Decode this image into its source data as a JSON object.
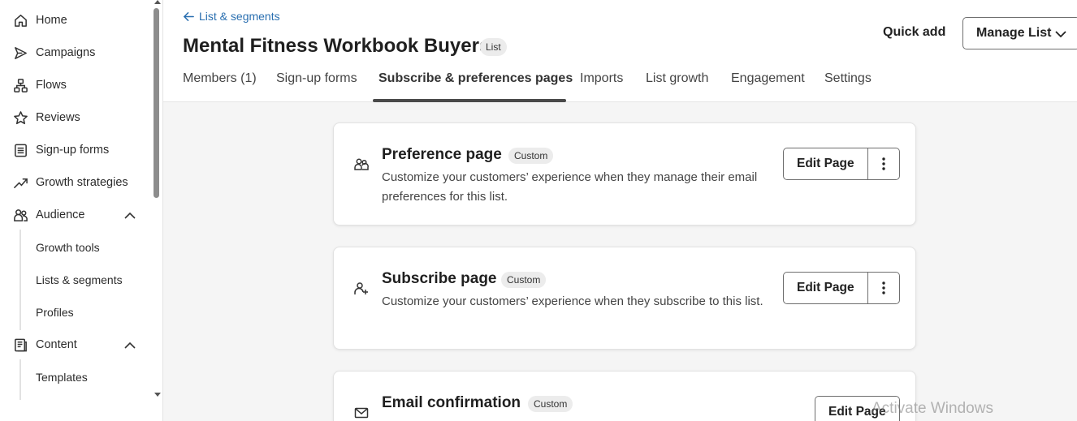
{
  "sidebar": {
    "items": [
      {
        "label": "Home",
        "icon": "home-icon"
      },
      {
        "label": "Campaigns",
        "icon": "send-icon"
      },
      {
        "label": "Flows",
        "icon": "flow-icon"
      },
      {
        "label": "Reviews",
        "icon": "star-icon"
      },
      {
        "label": "Sign-up forms",
        "icon": "form-icon"
      },
      {
        "label": "Growth strategies",
        "icon": "trend-icon"
      },
      {
        "label": "Audience",
        "icon": "users-icon"
      },
      {
        "label": "Content",
        "icon": "content-icon"
      }
    ],
    "audience_sub": [
      "Growth tools",
      "Lists & segments",
      "Profiles"
    ],
    "content_sub": [
      "Templates"
    ]
  },
  "header": {
    "back_label": "List & segments",
    "title": "Mental Fitness Workbook Buyers",
    "badge": "List",
    "quick_add": "Quick add",
    "manage_label": "Manage List"
  },
  "tabs": [
    {
      "label": "Members (1)"
    },
    {
      "label": "Sign-up forms"
    },
    {
      "label": "Subscribe & preferences pages",
      "active": true
    },
    {
      "label": "Imports"
    },
    {
      "label": "List growth"
    },
    {
      "label": "Engagement"
    },
    {
      "label": "Settings"
    }
  ],
  "cards": [
    {
      "title": "Preference page",
      "badge": "Custom",
      "description": "Customize your customers’ experience when they manage their email preferences for this list.",
      "action": "Edit Page",
      "icon": "people-icon"
    },
    {
      "title": "Subscribe page",
      "badge": "Custom",
      "description": "Customize your customers’ experience when they subscribe to this list.",
      "action": "Edit Page",
      "icon": "user-add-icon"
    },
    {
      "title": "Email confirmation",
      "badge": "Custom",
      "description": "",
      "action": "Edit Page",
      "icon": "mail-icon"
    }
  ],
  "watermark": "Activate Windows",
  "colors": {
    "link": "#2a6fb0",
    "active_underline": "#4a4a4a",
    "background": "#f5f5f5"
  }
}
